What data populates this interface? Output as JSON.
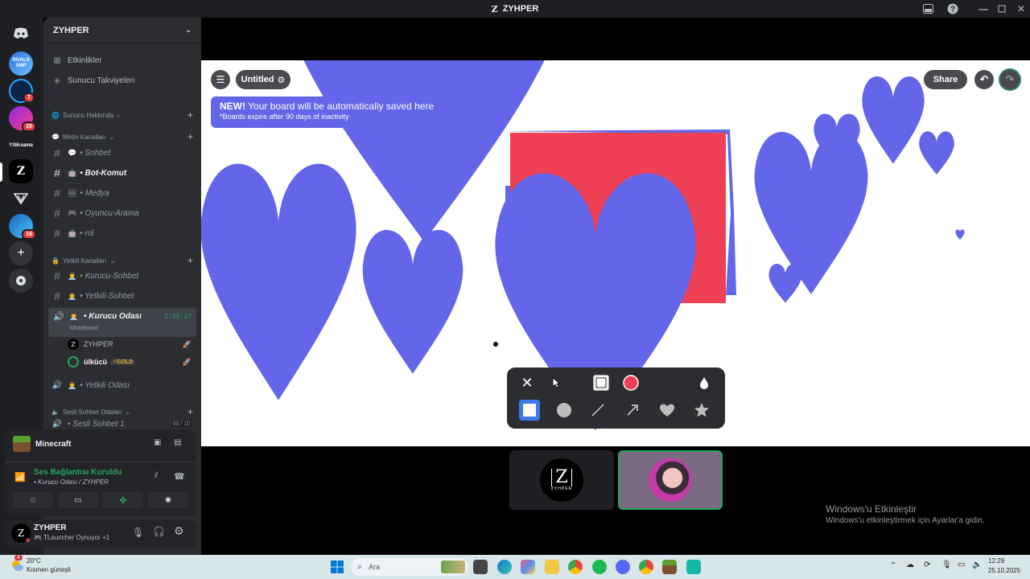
{
  "window": {
    "title": "ZYHPER"
  },
  "rail": {
    "servers": [
      {
        "name": "Discord home",
        "badge": ""
      },
      {
        "name": "server-1",
        "badge": ""
      },
      {
        "name": "server-2",
        "badge": "7"
      },
      {
        "name": "server-3",
        "badge": "16"
      },
      {
        "name": "server-4",
        "badge": ""
      },
      {
        "name": "ZYHPER",
        "badge": ""
      },
      {
        "name": "server-6",
        "badge": ""
      },
      {
        "name": "server-7",
        "badge": "16"
      }
    ],
    "srv1_text": "RIVALS SMP",
    "srv5_text": "Y!Mcsama",
    "zyhper_letter": "Z"
  },
  "sidebar": {
    "server_name": "ZYHPER",
    "top_items": [
      "Etkinlikler",
      "Sunucu Takviyeleri"
    ],
    "categories": {
      "about": "Sunucu Hakkında",
      "text": "Metin Kanalları",
      "staff": "Yetkili Kanalları",
      "voice": "Sesli Sohbet Odaları"
    },
    "text_channels": [
      "• Sohbet",
      "• Bot-Komut",
      "• Medya",
      "• Oyuncu-Arama",
      "• rol"
    ],
    "staff_channels": [
      "• Kurucu-Sohbet",
      "• Yetkili-Sohbet"
    ],
    "active_voice": {
      "name": "• Kurucu Odası",
      "timer": "2:55:27",
      "activity": "Whiteboard"
    },
    "voice_members": [
      {
        "name": "ZYHPER",
        "tag": ""
      },
      {
        "name": "ülkücü",
        "tag": "⚡GOLD"
      }
    ],
    "other_voice": "• Yetkili Odası",
    "partial_channel": "• Sesli Sohbet 1",
    "partial_count": "00 / 10"
  },
  "voice_panel": {
    "activity": "Minecraft",
    "status": "Ses Bağlantısı Kuruldu",
    "location": "• Kurucu Odası / ZYHPER"
  },
  "user_panel": {
    "username": "ZYHPER",
    "status": "TLauncher Oynuyor +1"
  },
  "whiteboard": {
    "board_name": "Untitled",
    "share_label": "Share",
    "banner_title": "NEW!",
    "banner_text": "Your board will be automatically saved here",
    "banner_sub": "*Boards expire after 90 days of inactivity",
    "colors": {
      "shape": "#6366e8",
      "rect": "#ef4056",
      "banner": "#6366e8"
    }
  },
  "toolbar": {
    "tools": [
      "close-icon",
      "cursor",
      "fill-square",
      "color-red",
      "drop-icon",
      "square",
      "circle",
      "line",
      "arrow",
      "heart",
      "star"
    ]
  },
  "thumbnails": [
    {
      "name": "ZYHPER",
      "letter": "Z",
      "sub": "ZYHPER"
    },
    {
      "name": "avatar-2"
    }
  ],
  "watermark": {
    "title": "Windows'u Etkinleştir",
    "text": "Windows'u etkinleştirmek için Ayarlar'a gidin."
  },
  "taskbar": {
    "weather_temp": "20°C",
    "weather_desc": "Kısmen güneşli",
    "weather_badge": "4",
    "search_placeholder": "Ara",
    "time": "12:29",
    "date": "25.10.2025"
  }
}
